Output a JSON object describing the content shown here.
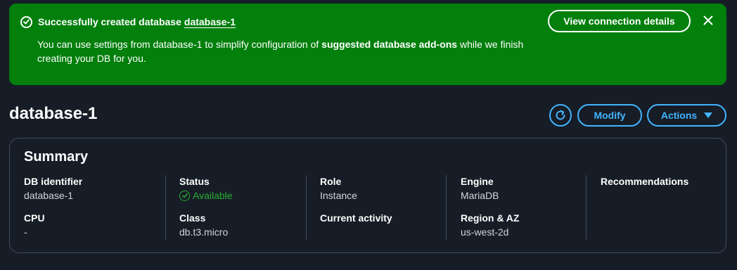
{
  "flash": {
    "title_prefix": "Successfully created database",
    "title_link": "database-1",
    "body_part1": "You can use settings from database-1 to simplify configuration of ",
    "body_bold": "suggested database add-ons",
    "body_part2": " while we finish creating your DB for you.",
    "view_button": "View connection details",
    "icon": "check-circle-icon",
    "close_icon": "close-icon",
    "color": "#037f0c"
  },
  "header": {
    "title": "database-1",
    "refresh_icon": "refresh-icon",
    "modify_label": "Modify",
    "actions_label": "Actions",
    "accent": "#42b4ff"
  },
  "summary": {
    "title": "Summary",
    "db_identifier_label": "DB identifier",
    "db_identifier_value": "database-1",
    "cpu_label": "CPU",
    "cpu_value": "-",
    "status_label": "Status",
    "status_value": "Available",
    "status_color": "#29ad32",
    "class_label": "Class",
    "class_value": "db.t3.micro",
    "role_label": "Role",
    "role_value": "Instance",
    "current_activity_label": "Current activity",
    "engine_label": "Engine",
    "engine_value": "MariaDB",
    "region_label": "Region & AZ",
    "region_value": "us-west-2d",
    "recommendations_label": "Recommendations"
  }
}
